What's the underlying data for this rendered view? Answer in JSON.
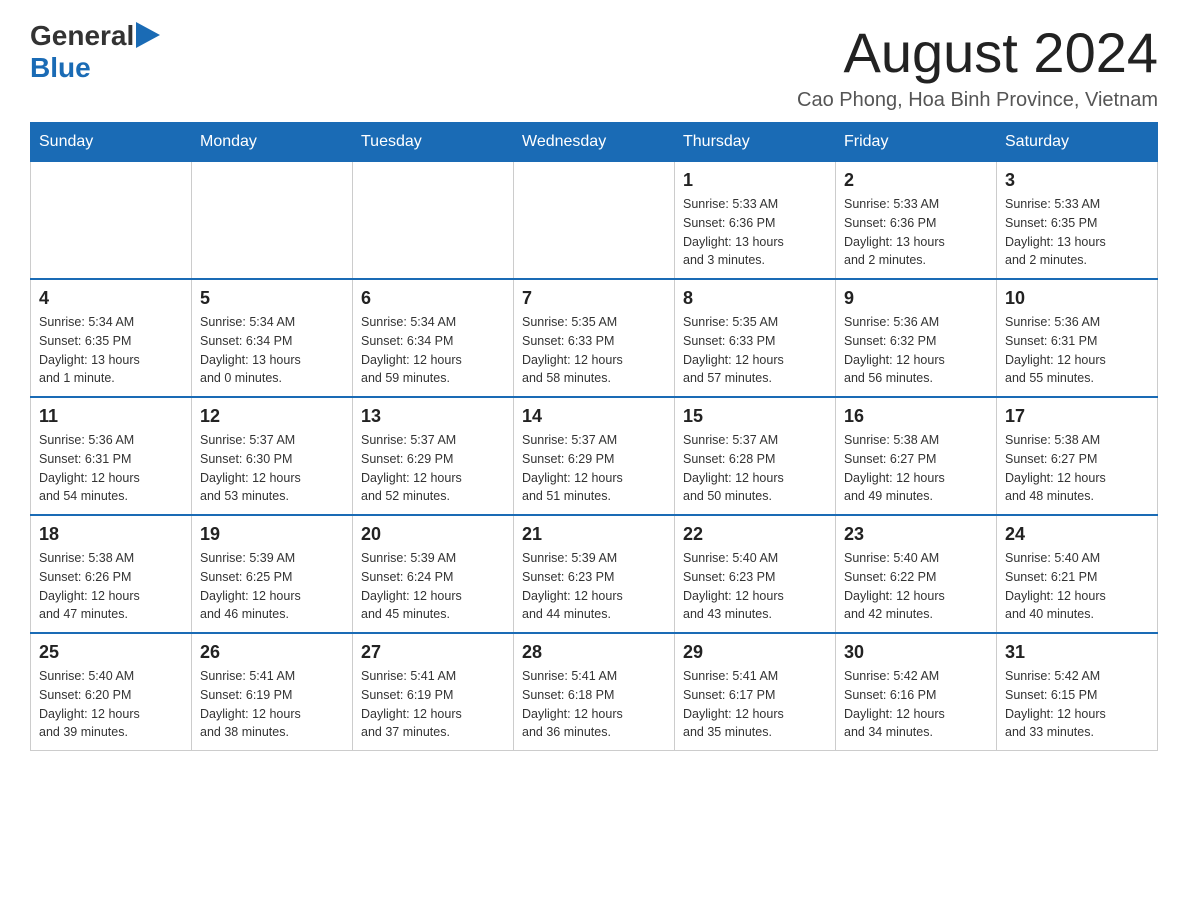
{
  "header": {
    "logo_general": "General",
    "logo_blue": "Blue",
    "title": "August 2024",
    "subtitle": "Cao Phong, Hoa Binh Province, Vietnam"
  },
  "days_of_week": [
    "Sunday",
    "Monday",
    "Tuesday",
    "Wednesday",
    "Thursday",
    "Friday",
    "Saturday"
  ],
  "weeks": [
    {
      "days": [
        {
          "number": "",
          "info": ""
        },
        {
          "number": "",
          "info": ""
        },
        {
          "number": "",
          "info": ""
        },
        {
          "number": "",
          "info": ""
        },
        {
          "number": "1",
          "info": "Sunrise: 5:33 AM\nSunset: 6:36 PM\nDaylight: 13 hours\nand 3 minutes."
        },
        {
          "number": "2",
          "info": "Sunrise: 5:33 AM\nSunset: 6:36 PM\nDaylight: 13 hours\nand 2 minutes."
        },
        {
          "number": "3",
          "info": "Sunrise: 5:33 AM\nSunset: 6:35 PM\nDaylight: 13 hours\nand 2 minutes."
        }
      ]
    },
    {
      "days": [
        {
          "number": "4",
          "info": "Sunrise: 5:34 AM\nSunset: 6:35 PM\nDaylight: 13 hours\nand 1 minute."
        },
        {
          "number": "5",
          "info": "Sunrise: 5:34 AM\nSunset: 6:34 PM\nDaylight: 13 hours\nand 0 minutes."
        },
        {
          "number": "6",
          "info": "Sunrise: 5:34 AM\nSunset: 6:34 PM\nDaylight: 12 hours\nand 59 minutes."
        },
        {
          "number": "7",
          "info": "Sunrise: 5:35 AM\nSunset: 6:33 PM\nDaylight: 12 hours\nand 58 minutes."
        },
        {
          "number": "8",
          "info": "Sunrise: 5:35 AM\nSunset: 6:33 PM\nDaylight: 12 hours\nand 57 minutes."
        },
        {
          "number": "9",
          "info": "Sunrise: 5:36 AM\nSunset: 6:32 PM\nDaylight: 12 hours\nand 56 minutes."
        },
        {
          "number": "10",
          "info": "Sunrise: 5:36 AM\nSunset: 6:31 PM\nDaylight: 12 hours\nand 55 minutes."
        }
      ]
    },
    {
      "days": [
        {
          "number": "11",
          "info": "Sunrise: 5:36 AM\nSunset: 6:31 PM\nDaylight: 12 hours\nand 54 minutes."
        },
        {
          "number": "12",
          "info": "Sunrise: 5:37 AM\nSunset: 6:30 PM\nDaylight: 12 hours\nand 53 minutes."
        },
        {
          "number": "13",
          "info": "Sunrise: 5:37 AM\nSunset: 6:29 PM\nDaylight: 12 hours\nand 52 minutes."
        },
        {
          "number": "14",
          "info": "Sunrise: 5:37 AM\nSunset: 6:29 PM\nDaylight: 12 hours\nand 51 minutes."
        },
        {
          "number": "15",
          "info": "Sunrise: 5:37 AM\nSunset: 6:28 PM\nDaylight: 12 hours\nand 50 minutes."
        },
        {
          "number": "16",
          "info": "Sunrise: 5:38 AM\nSunset: 6:27 PM\nDaylight: 12 hours\nand 49 minutes."
        },
        {
          "number": "17",
          "info": "Sunrise: 5:38 AM\nSunset: 6:27 PM\nDaylight: 12 hours\nand 48 minutes."
        }
      ]
    },
    {
      "days": [
        {
          "number": "18",
          "info": "Sunrise: 5:38 AM\nSunset: 6:26 PM\nDaylight: 12 hours\nand 47 minutes."
        },
        {
          "number": "19",
          "info": "Sunrise: 5:39 AM\nSunset: 6:25 PM\nDaylight: 12 hours\nand 46 minutes."
        },
        {
          "number": "20",
          "info": "Sunrise: 5:39 AM\nSunset: 6:24 PM\nDaylight: 12 hours\nand 45 minutes."
        },
        {
          "number": "21",
          "info": "Sunrise: 5:39 AM\nSunset: 6:23 PM\nDaylight: 12 hours\nand 44 minutes."
        },
        {
          "number": "22",
          "info": "Sunrise: 5:40 AM\nSunset: 6:23 PM\nDaylight: 12 hours\nand 43 minutes."
        },
        {
          "number": "23",
          "info": "Sunrise: 5:40 AM\nSunset: 6:22 PM\nDaylight: 12 hours\nand 42 minutes."
        },
        {
          "number": "24",
          "info": "Sunrise: 5:40 AM\nSunset: 6:21 PM\nDaylight: 12 hours\nand 40 minutes."
        }
      ]
    },
    {
      "days": [
        {
          "number": "25",
          "info": "Sunrise: 5:40 AM\nSunset: 6:20 PM\nDaylight: 12 hours\nand 39 minutes."
        },
        {
          "number": "26",
          "info": "Sunrise: 5:41 AM\nSunset: 6:19 PM\nDaylight: 12 hours\nand 38 minutes."
        },
        {
          "number": "27",
          "info": "Sunrise: 5:41 AM\nSunset: 6:19 PM\nDaylight: 12 hours\nand 37 minutes."
        },
        {
          "number": "28",
          "info": "Sunrise: 5:41 AM\nSunset: 6:18 PM\nDaylight: 12 hours\nand 36 minutes."
        },
        {
          "number": "29",
          "info": "Sunrise: 5:41 AM\nSunset: 6:17 PM\nDaylight: 12 hours\nand 35 minutes."
        },
        {
          "number": "30",
          "info": "Sunrise: 5:42 AM\nSunset: 6:16 PM\nDaylight: 12 hours\nand 34 minutes."
        },
        {
          "number": "31",
          "info": "Sunrise: 5:42 AM\nSunset: 6:15 PM\nDaylight: 12 hours\nand 33 minutes."
        }
      ]
    }
  ]
}
